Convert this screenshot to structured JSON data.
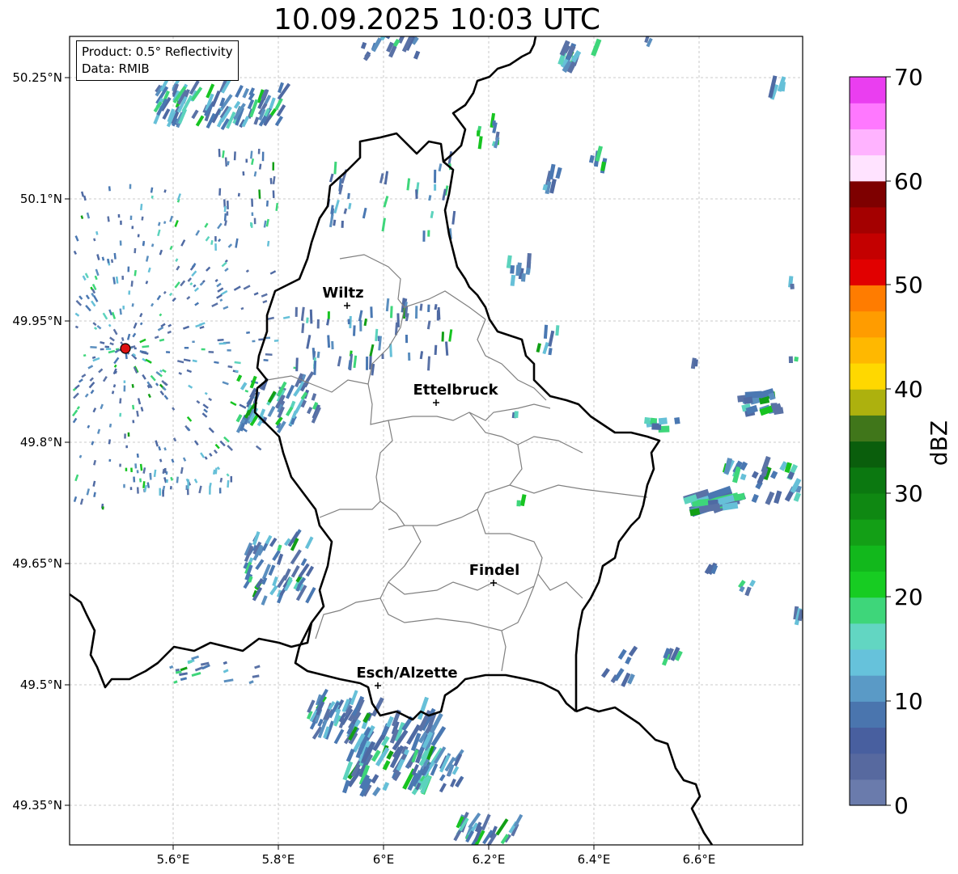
{
  "title": "10.09.2025 10:03 UTC",
  "info": {
    "product": "Product: 0.5° Reflectivity",
    "data": "Data: RMIB"
  },
  "axes": {
    "lon_ticks": [
      "5.6°E",
      "5.8°E",
      "6°E",
      "6.2°E",
      "6.4°E",
      "6.6°E"
    ],
    "lat_ticks": [
      "50.25°N",
      "50.1°N",
      "49.95°N",
      "49.8°N",
      "49.65°N",
      "49.5°N",
      "49.35°N"
    ]
  },
  "cities": [
    {
      "name": "Wiltz"
    },
    {
      "name": "Ettelbruck"
    },
    {
      "name": "Findel"
    },
    {
      "name": "Esch/Alzette"
    }
  ],
  "colorbar": {
    "label": "dBZ",
    "ticks": [
      "0",
      "10",
      "20",
      "30",
      "40",
      "50",
      "60",
      "70"
    ],
    "colors": [
      "#6a7bac",
      "#57699f",
      "#485f9f",
      "#4a75ae",
      "#5a9ac6",
      "#66c2db",
      "#62d6c2",
      "#3ed67a",
      "#17cc22",
      "#12b81c",
      "#139f16",
      "#0f8812",
      "#0b7810",
      "#0a5e0c",
      "#40761a",
      "#adb10e",
      "#ffd800",
      "#ffb800",
      "#ff9c00",
      "#ff7c00",
      "#e10000",
      "#c40000",
      "#a40000",
      "#7e0000",
      "#ffe3ff",
      "#ffb3ff",
      "#ff78ff",
      "#ea3ef0"
    ]
  },
  "colors": {
    "border": "#000000",
    "cantons": "#808080",
    "radar_site": "#dd1111"
  }
}
